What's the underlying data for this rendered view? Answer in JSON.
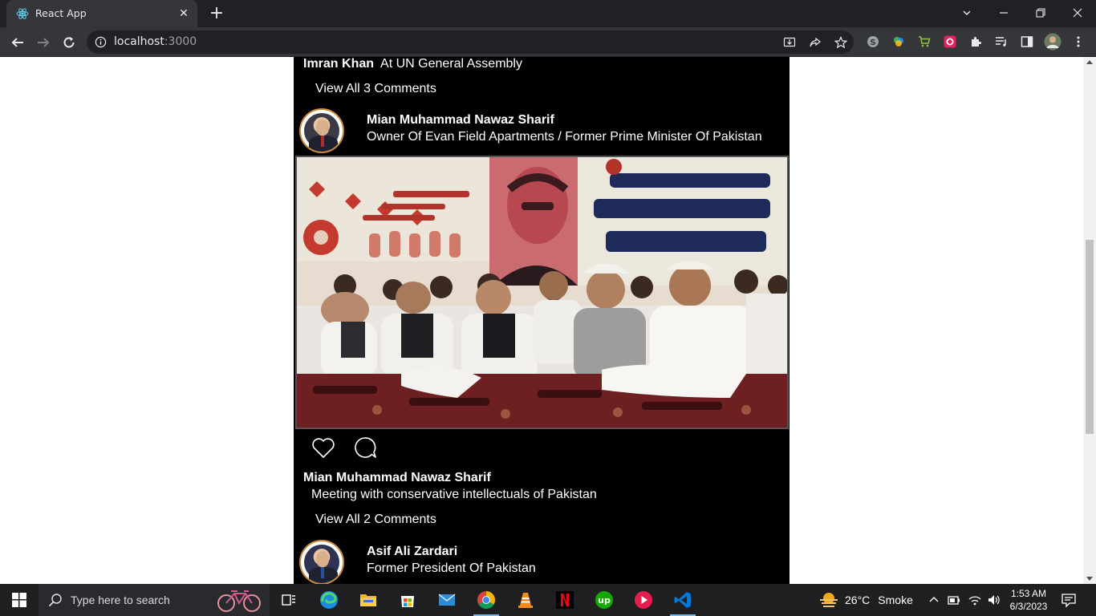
{
  "browser": {
    "tab_title": "React App",
    "url_host": "localhost",
    "url_port": ":3000"
  },
  "feed": {
    "prev_post": {
      "author": "Imran Khan",
      "caption": "At UN General Assembly",
      "comments_link": "View All 3 Comments"
    },
    "post": {
      "user_name": "Mian Muhammad Nawaz Sharif",
      "user_title": "Owner Of Evan Field Apartments / Former Prime Minister Of Pakistan",
      "author": "Mian Muhammad Nawaz Sharif",
      "caption": "Meeting with conservative intellectuals of Pakistan",
      "comments_link": "View All 2 Comments"
    },
    "next_post": {
      "user_name": "Asif Ali Zardari",
      "user_title": "Former President Of Pakistan"
    }
  },
  "taskbar": {
    "search_placeholder": "Type here to search",
    "temperature": "26°C",
    "weather": "Smoke",
    "time": "1:53 AM",
    "date": "6/3/2023"
  }
}
